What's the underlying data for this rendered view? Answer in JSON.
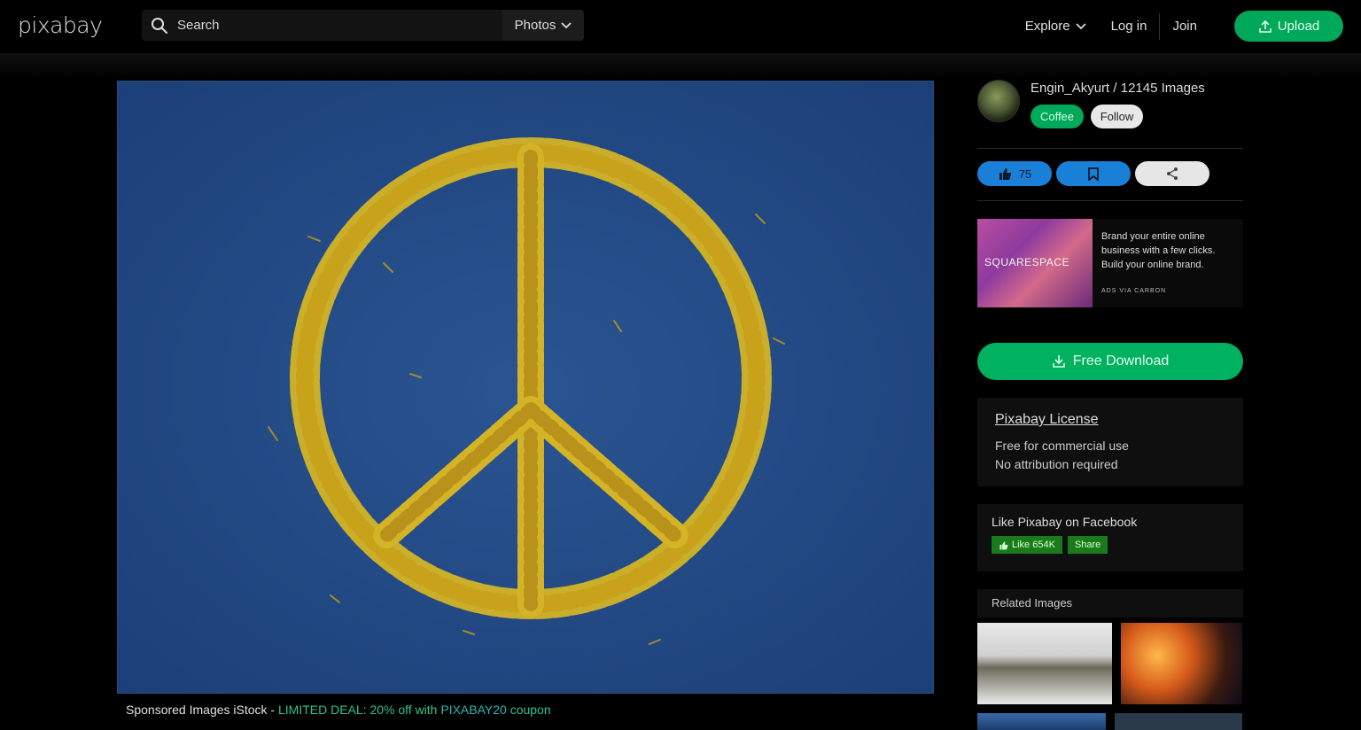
{
  "header": {
    "logo": "pixabay",
    "search_placeholder": "Search",
    "media_type": "Photos",
    "nav": {
      "explore": "Explore",
      "login": "Log in",
      "join": "Join",
      "upload": "Upload"
    }
  },
  "sponsored": {
    "prefix": "Sponsored Images iStock - ",
    "deal": "LIMITED DEAL: 20% off with ",
    "code": "PIXABAY20",
    "suffix": " coupon"
  },
  "author": {
    "name": "Engin_Akyurt",
    "separator": " / ",
    "image_count": "12145 Images",
    "coffee_label": "Coffee",
    "follow_label": "Follow"
  },
  "actions": {
    "likes": "75"
  },
  "ad": {
    "brand": "SQUARESPACE",
    "line1": "Brand your entire online",
    "line2": "business with a few clicks.",
    "line3": "Build your online brand.",
    "cta": "ADS VIA CARBON"
  },
  "download": {
    "label": "Free Download"
  },
  "license": {
    "title": "Pixabay License",
    "line1": "Free for commercial use",
    "line2": "No attribution required"
  },
  "facebook": {
    "title": "Like Pixabay on Facebook",
    "like_label": "Like 654K",
    "share_label": "Share"
  },
  "related": {
    "title": "Related Images"
  },
  "colors": {
    "accent_green": "#00a859",
    "accent_blue": "#1a7fd6",
    "image_bg": "#234a86",
    "petal": "#d4b426"
  }
}
